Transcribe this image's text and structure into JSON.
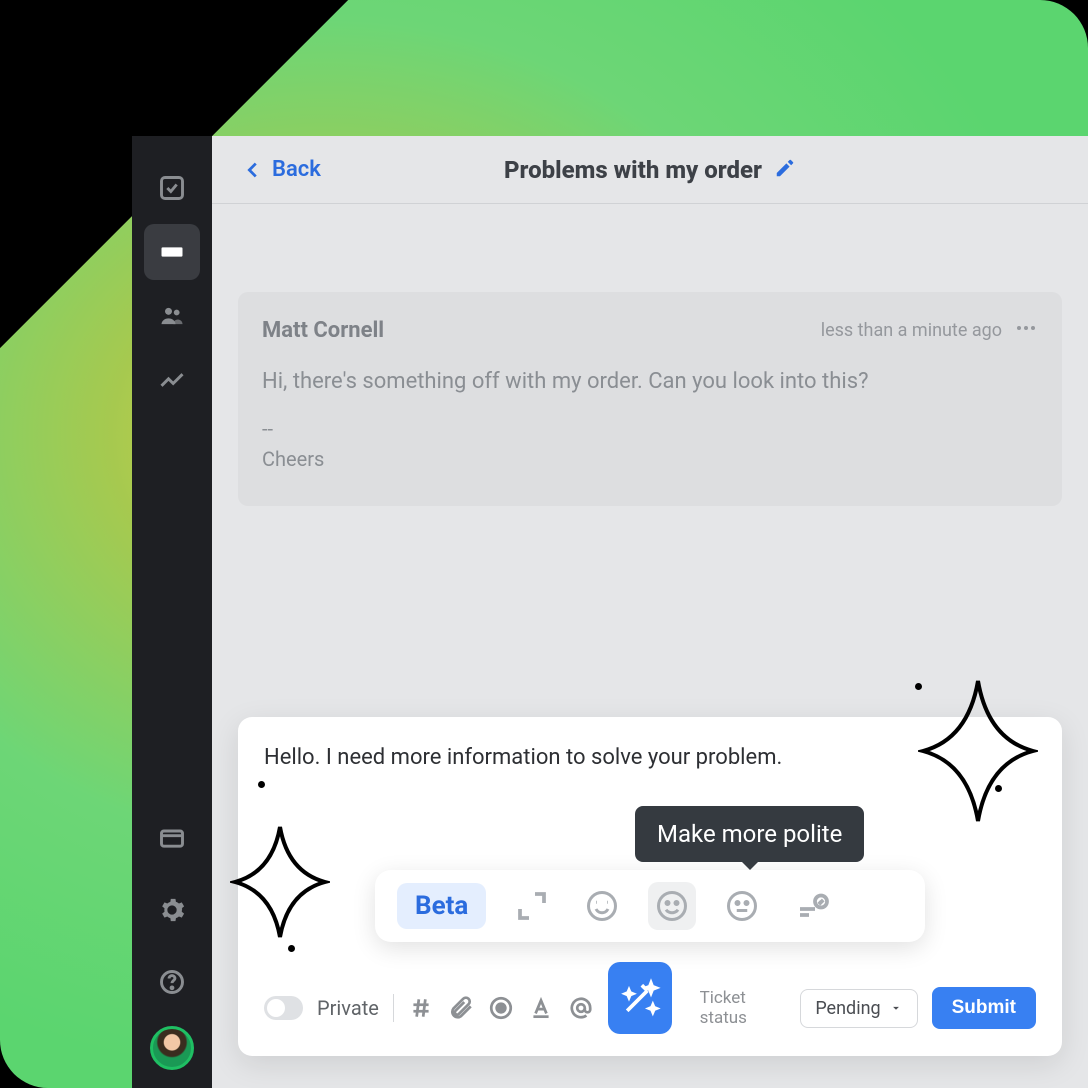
{
  "header": {
    "back_label": "Back",
    "title": "Problems with my order"
  },
  "message": {
    "sender": "Matt Cornell",
    "timestamp": "less than a minute ago",
    "body": "Hi, there's something off with my order. Can you look into this?",
    "sig_dash": "--",
    "sig": "Cheers"
  },
  "compose": {
    "draft": "Hello. I need more information to solve your problem.",
    "beta_label": "Beta",
    "tooltip": "Make more polite"
  },
  "footer": {
    "private_label": "Private",
    "status_label": "Ticket status",
    "status_value": "Pending",
    "submit_label": "Submit"
  }
}
